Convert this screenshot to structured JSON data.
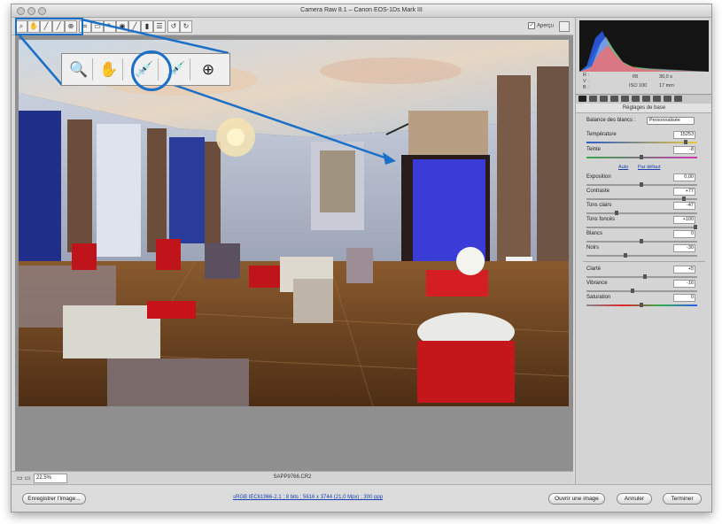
{
  "window": {
    "title": "Camera Raw 8.1  –  Canon EOS-1Ds Mark III"
  },
  "toolbar": {
    "tools": [
      "zoom-tool",
      "hand-tool",
      "white-balance-tool",
      "color-sampler-tool",
      "targeted-adjustment-tool",
      "crop-tool",
      "straighten-tool",
      "spot-removal-tool",
      "red-eye-tool",
      "adjustment-brush-tool",
      "graduated-filter-tool",
      "radial-filter-tool",
      "preferences",
      "rotate-left",
      "rotate-right"
    ],
    "preview_label": "Aperçu"
  },
  "zoom_callout": {
    "tools": [
      "zoom-icon",
      "hand-icon",
      "eyedropper-icon",
      "color-sampler-icon",
      "targeted-adjustment-icon"
    ],
    "glyphs": [
      "🔍",
      "✋",
      "💉",
      "💉",
      "⊕"
    ]
  },
  "image": {
    "filename": "SAPP9766.CR2",
    "zoom": "22.5%"
  },
  "camera_info": {
    "r": "R :",
    "g": "V :",
    "b": "B :",
    "aperture": "f/8",
    "shutter": "30,0 s",
    "iso": "ISO 100",
    "focal": "17 mm"
  },
  "panel": {
    "title": "Réglages de base",
    "wb_label": "Balance des blancs :",
    "wb_value": "Personnalisée",
    "temperature_label": "Température",
    "temperature_value": "15253",
    "tint_label": "Teinte",
    "tint_value": "-8",
    "auto_link": "Auto",
    "default_link": "Par défaut",
    "exposure_label": "Exposition",
    "exposure_value": "0,00",
    "contrast_label": "Contraste",
    "contrast_value": "+77",
    "highlights_label": "Tons clairs",
    "highlights_value": "-47",
    "shadows_label": "Tons foncés",
    "shadows_value": "+100",
    "whites_label": "Blancs",
    "whites_value": "0",
    "blacks_label": "Noirs",
    "blacks_value": "-30",
    "clarity_label": "Clarté",
    "clarity_value": "+5",
    "vibrance_label": "Vibrance",
    "vibrance_value": "-16",
    "saturation_label": "Saturation",
    "saturation_value": "0"
  },
  "bottom": {
    "save_label": "Enregistrer l'image...",
    "workflow_text": "sRGB IEC61966-2.1 ; 8 bits ; 5616 x 3744 (21,0 Mpx) ; 300 ppp",
    "open_label": "Ouvrir une image",
    "cancel_label": "Annuler",
    "done_label": "Terminer"
  }
}
